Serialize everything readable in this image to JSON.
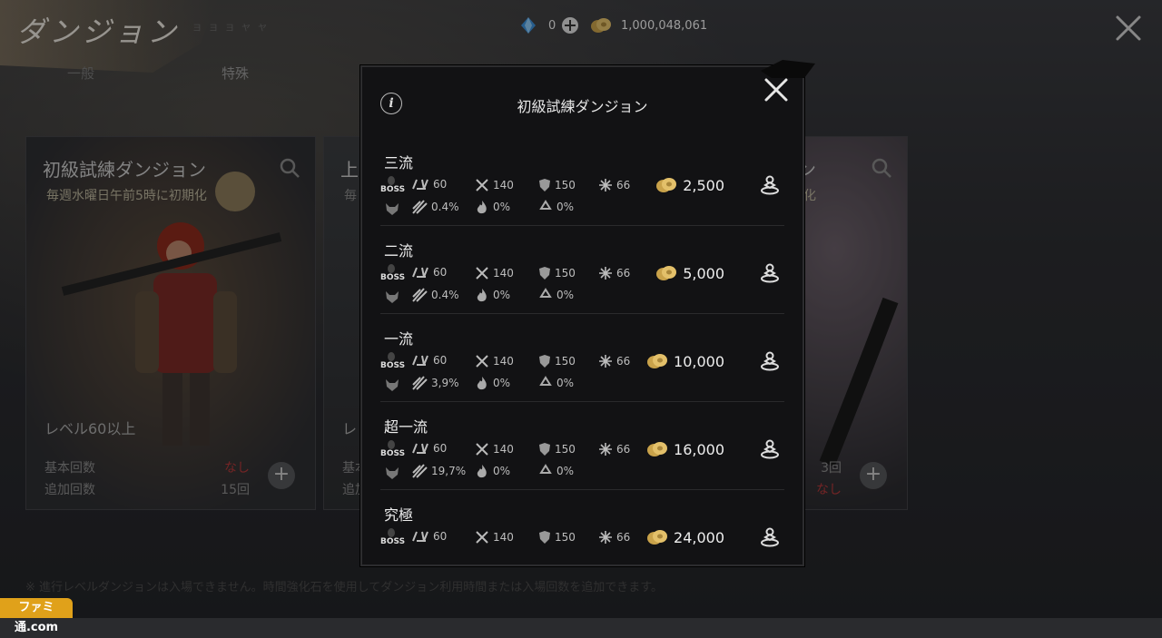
{
  "header": {
    "title": "ダンジョン",
    "subtitle": "ヨヨヨヤヤ",
    "tabs": [
      {
        "label": "一般"
      },
      {
        "label": "特殊"
      }
    ],
    "diamond_count": "0",
    "gold_count": "1,000,048,061"
  },
  "cards": [
    {
      "title": "初級試練ダンジョン",
      "reset": "毎週水曜日午前5時に初期化",
      "level": "レベル60以上",
      "base_label": "基本回数",
      "base_value": "なし",
      "extra_label": "追加回数",
      "extra_value": "15回"
    },
    {
      "title": "上",
      "reset": "毎",
      "level": "レ",
      "base_label": "基本",
      "extra_label": "追加"
    },
    {
      "title": "ン",
      "reset": "化",
      "base_value": "3回",
      "extra_value": "なし"
    }
  ],
  "footer_note": "※ 進行レベルダンジョンは入場できません。時間強化石を使用してダンジョン利用時間または入場回数を追加できます。",
  "logo": "ファミ通.com",
  "modal": {
    "title": "初級試練ダンジョン",
    "rows": [
      {
        "name": "三流",
        "boss": "BOSS",
        "lv": "60",
        "atk": "140",
        "def": "150",
        "acc": "66",
        "crit": "0.4%",
        "burn": "0%",
        "recovery": "0%",
        "reward": "2,500"
      },
      {
        "name": "二流",
        "boss": "BOSS",
        "lv": "60",
        "atk": "140",
        "def": "150",
        "acc": "66",
        "crit": "0.4%",
        "burn": "0%",
        "recovery": "0%",
        "reward": "5,000"
      },
      {
        "name": "一流",
        "boss": "BOSS",
        "lv": "60",
        "atk": "140",
        "def": "150",
        "acc": "66",
        "crit": "3,9%",
        "burn": "0%",
        "recovery": "0%",
        "reward": "10,000"
      },
      {
        "name": "超一流",
        "boss": "BOSS",
        "lv": "60",
        "atk": "140",
        "def": "150",
        "acc": "66",
        "crit": "19,7%",
        "burn": "0%",
        "recovery": "0%",
        "reward": "16,000"
      },
      {
        "name": "究極",
        "boss": "BOSS",
        "lv": "60",
        "atk": "140",
        "def": "150",
        "acc": "66",
        "reward": "24,000"
      }
    ]
  }
}
